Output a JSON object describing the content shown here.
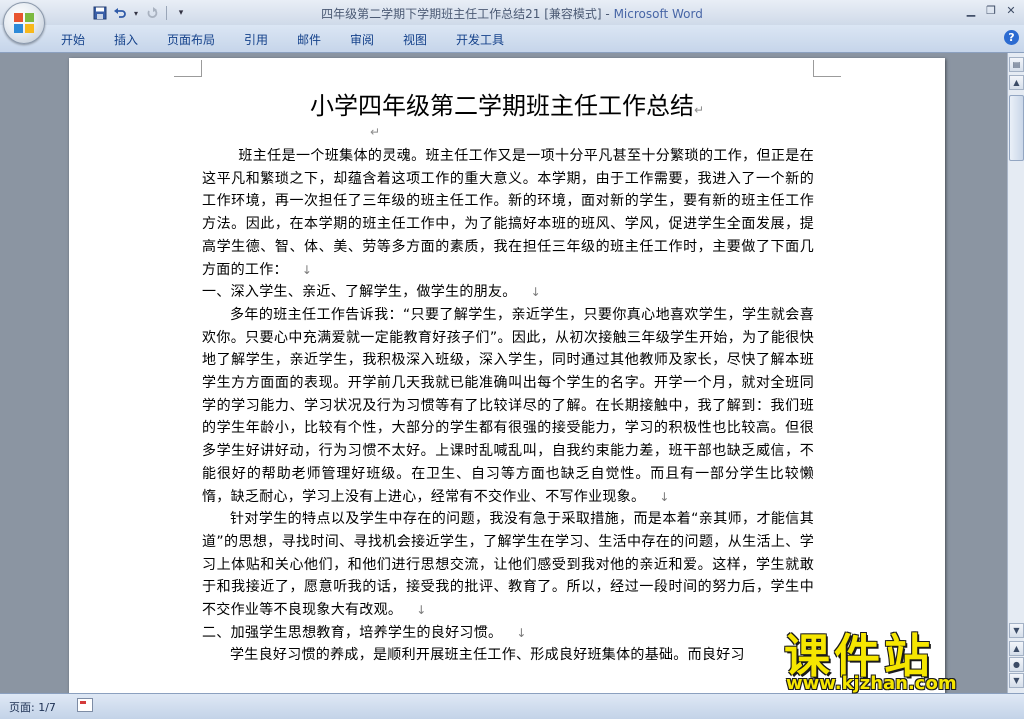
{
  "window": {
    "title_doc": "四年级第二学期下学期班主任工作总结21 [兼容模式] - ",
    "title_app": "Microsoft Word"
  },
  "qat": {
    "icons": [
      "save-icon",
      "undo-icon",
      "redo-icon",
      "customize-icon"
    ]
  },
  "ribbon": {
    "tabs": [
      "开始",
      "插入",
      "页面布局",
      "引用",
      "邮件",
      "审阅",
      "视图",
      "开发工具"
    ]
  },
  "document": {
    "title": "小学四年级第二学期班主任工作总结",
    "para_mark": "↵",
    "line_break_mark": "↓",
    "paragraphs": [
      "班主任是一个班集体的灵魂。班主任工作又是一项十分平凡甚至十分繁琐的工作，但正是在这平凡和繁琐之下，却蕴含着这项工作的重大意义。本学期，由于工作需要，我进入了一个新的工作环境，再一次担任了三年级的班主任工作。新的环境，面对新的学生，要有新的班主任工作方法。因此，在本学期的班主任工作中，为了能搞好本班的班风、学风，促进学生全面发展，提高学生德、智、体、美、劳等多方面的素质，我在担任三年级的班主任工作时，主要做了下面几方面的工作：",
      "一、深入学生、亲近、了解学生，做学生的朋友。",
      "多年的班主任工作告诉我：“只要了解学生，亲近学生，只要你真心地喜欢学生，学生就会喜欢你。只要心中充满爱就一定能教育好孩子们”。因此，从初次接触三年级学生开始，为了能很快地了解学生，亲近学生，我积极深入班级，深入学生，同时通过其他教师及家长，尽快了解本班学生方方面面的表现。开学前几天我就已能准确叫出每个学生的名字。开学一个月，就对全班同学的学习能力、学习状况及行为习惯等有了比较详尽的了解。在长期接触中，我了解到：我们班的学生年龄小，比较有个性，大部分的学生都有很强的接受能力，学习的积极性也比较高。但很多学生好讲好动，行为习惯不太好。上课时乱喊乱叫，自我约束能力差，班干部也缺乏威信，不能很好的帮助老师管理好班级。在卫生、自习等方面也缺乏自觉性。而且有一部分学生比较懒惰，缺乏耐心，学习上没有上进心，经常有不交作业、不写作业现象。",
      "针对学生的特点以及学生中存在的问题，我没有急于采取措施，而是本着“亲其师，才能信其道”的思想，寻找时间、寻找机会接近学生，了解学生在学习、生活中存在的问题，从生活上、学习上体贴和关心他们，和他们进行思想交流，让他们感受到我对他的亲近和爱。这样，学生就敢于和我接近了，愿意听我的话，接受我的批评、教育了。所以，经过一段时间的努力后，学生中不交作业等不良现象大有改观。",
      "二、加强学生思想教育，培养学生的良好习惯。",
      "学生良好习惯的养成，是顺利开展班主任工作、形成良好班集体的基础。而良好习"
    ]
  },
  "statusbar": {
    "page_label": "页面: 1/7"
  },
  "watermark": {
    "title": "课件站",
    "url": "www.kjzhan.com"
  },
  "colors": {
    "ribbon_text": "#15428b",
    "workspace": "#8b95a2",
    "watermark": "#f6e600"
  }
}
